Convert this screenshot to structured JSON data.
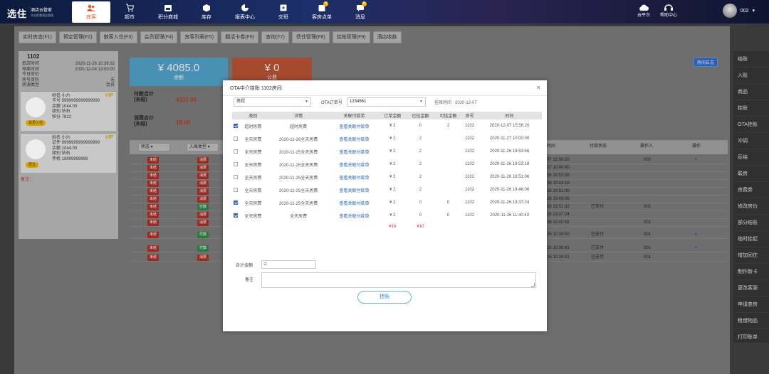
{
  "app": {
    "logo_main": "选住",
    "logo_name": "酒店云管家",
    "logo_tagline": "开启智慧酒店管理"
  },
  "nav": [
    {
      "label": "宾客",
      "icon": "users-icon",
      "active": true
    },
    {
      "label": "超市",
      "icon": "cart-icon"
    },
    {
      "label": "积分商城",
      "icon": "shop-icon"
    },
    {
      "label": "库存",
      "icon": "box-icon"
    },
    {
      "label": "报表中心",
      "icon": "pie-chart-icon"
    },
    {
      "label": "交班",
      "icon": "handover-icon"
    },
    {
      "label": "客房点单",
      "icon": "room-order-icon",
      "badge": "0"
    },
    {
      "label": "消息",
      "icon": "message-icon",
      "badge": "8"
    }
  ],
  "topright": {
    "cloud_label": "云平台",
    "help_label": "帮助中心",
    "user": "002"
  },
  "tabs": [
    "实时房态(F1)",
    "预定管理(F2)",
    "散客入住(F3)",
    "会员管理(F4)",
    "宾客列表(F5)",
    "翻活卡卷(F6)",
    "查询(F7)",
    "债住管理(F8)",
    "挂账管理(F9)",
    "酒店收款"
  ],
  "room": {
    "number": "1102",
    "fields": [
      {
        "k": "抵店时间",
        "v": "2020-11-26 10:39:32"
      },
      {
        "k": "预离时间",
        "v": "2020-12-04 13:00:00"
      },
      {
        "k": "今日房价",
        "v": ""
      },
      {
        "k": "房号资料",
        "v": "无"
      },
      {
        "k": "房源类型",
        "v": "会员"
      }
    ]
  },
  "guests": [
    {
      "name": "姓名 小六",
      "card": "卡号 9999999999999999",
      "balance": "余额 1044.00",
      "level": "级别 钻石",
      "points": "积分 7822",
      "vip": "VIP",
      "btn": "会员入住"
    },
    {
      "name": "姓名 小六",
      "card": "证件 9999999999999999",
      "balance": "余额 1044.00",
      "level": "级别 钻石",
      "points": "手机 18999999999",
      "vip": "VIP",
      "btn": "再五"
    }
  ],
  "remark_label": "备注：",
  "cards": {
    "balance": "¥ 4085.0",
    "balance_label": "余额",
    "deposit": "¥ 0",
    "deposit_label": "公费"
  },
  "summary": {
    "paid_label": "付款合计\n(未结)",
    "paid_value": "4101.00",
    "consume_label": "消费合计\n(未结)",
    "consume_value": "16.00"
  },
  "filter": {
    "status": "状态",
    "type": "入账类型",
    "time_col": "时间",
    "pay_col": "付款状态",
    "operator_col": "操作人",
    "op_col": "操作"
  },
  "log_button": "房间日志",
  "list_rows": [
    {
      "a": "未结",
      "b": "消费",
      "time": "07 15:56:20",
      "pay": "",
      "op": "002",
      "chev": true
    },
    {
      "a": "未结",
      "b": "消费",
      "time": "27 10:00:00",
      "pay": "",
      "op": "",
      "chev": false
    },
    {
      "a": "未结",
      "b": "消费",
      "time": "26 19:53:56",
      "pay": "",
      "op": "",
      "chev": false
    },
    {
      "a": "未结",
      "b": "消费",
      "time": "26 19:53:18",
      "pay": "",
      "op": "",
      "chev": false
    },
    {
      "a": "未结",
      "b": "消费",
      "time": "26 19:51:06",
      "pay": "",
      "op": "",
      "chev": false
    },
    {
      "a": "未结",
      "b": "消费",
      "time": "26 19:48:06",
      "pay": "",
      "op": "",
      "chev": false
    },
    {
      "a": "未结",
      "b": "付款",
      "time": "26 13:51:32",
      "pay": "已支付",
      "op": "001",
      "chev": false,
      "g": true
    },
    {
      "a": "未结",
      "b": "消费",
      "time": "26 13:37:24",
      "pay": "",
      "op": "",
      "chev": false
    },
    {
      "a": "未结",
      "b": "消费",
      "time": "26 11:40:43",
      "pay": "",
      "op": "001",
      "chev": false
    },
    {
      "a": "未结",
      "b": "付款",
      "time": "26 10:39:50",
      "pay": "已支付",
      "op": "001",
      "chev": true,
      "g": true
    },
    {
      "a": "未结",
      "b": "付款",
      "time": "26 10:39:41",
      "pay": "已支付",
      "op": "001",
      "chev": true,
      "g": true
    },
    {
      "a": "未结",
      "b": "消费",
      "time": "26 10:39:41",
      "pay": "已支付",
      "op": "001",
      "chev": false
    }
  ],
  "right_menu": [
    "结账",
    "入账",
    "商品",
    "挂账",
    "OTA挂账",
    "冲调",
    "反结",
    "联房",
    "房费券",
    "修改房价",
    "部分结账",
    "临时挂起",
    "增加同住",
    "制作新卡",
    "更改客源",
    "申请查房",
    "租借物品",
    "打印账单"
  ],
  "modal": {
    "title": "OTA中介挂账 1102房间",
    "close": "×",
    "channel": "携程",
    "ota_label": "OTA订单号",
    "ota_value": "1234561",
    "time_label": "挂账时间",
    "time_value": "2020-12-07",
    "headers": [
      "",
      "类别",
      "详情",
      "关联付款单",
      "订单金额",
      "已挂金额",
      "可挂金额",
      "房号",
      "时间"
    ],
    "rows": [
      {
        "checked": true,
        "cat": "超时房费",
        "detail": "超时房费",
        "link": "查看关联付款单",
        "amount": "¥ 2",
        "paid": "0",
        "avail": "2",
        "room": "1102",
        "time": "2020-12-07 15:56:20"
      },
      {
        "checked": false,
        "cat": "全天房费",
        "detail": "2020-11-26全天房费",
        "link": "查看关联付款单",
        "amount": "¥ 2",
        "paid": "2",
        "avail": "",
        "room": "1102",
        "time": "2020-11-27 10:00:00"
      },
      {
        "checked": false,
        "cat": "全天房费",
        "detail": "2020-11-25全天房费",
        "link": "查看关联付款单",
        "amount": "¥ 2",
        "paid": "2",
        "avail": "",
        "room": "1102",
        "time": "2020-11-26 19:53:56"
      },
      {
        "checked": false,
        "cat": "全天房费",
        "detail": "2020-11-25全天房费",
        "link": "查看关联付款单",
        "amount": "¥ 2",
        "paid": "2",
        "avail": "",
        "room": "1102",
        "time": "2020-11-26 19:53:18"
      },
      {
        "checked": false,
        "cat": "全天房费",
        "detail": "2020-11-25全天房费",
        "link": "查看关联付款单",
        "amount": "¥ 2",
        "paid": "2",
        "avail": "",
        "room": "1102",
        "time": "2020-11-26 19:51:06"
      },
      {
        "checked": false,
        "cat": "全天房费",
        "detail": "2020-11-25全天房费",
        "link": "查看关联付款单",
        "amount": "¥ 2",
        "paid": "2",
        "avail": "",
        "room": "1102",
        "time": "2020-11-26 19:48:06"
      },
      {
        "checked": true,
        "cat": "全天房费",
        "detail": "2020-11-25全天房费",
        "link": "查看关联付款单",
        "amount": "¥ 2",
        "paid": "0",
        "avail": "0",
        "room": "1102",
        "time": "2020-11-26 13:37:24"
      },
      {
        "checked": true,
        "cat": "全天房费",
        "detail": "全天房费",
        "link": "查看关联付款单",
        "amount": "¥ 2",
        "paid": "0",
        "avail": "0",
        "room": "1102",
        "time": "2020-11-26 11:40:43"
      }
    ],
    "total_amount": "¥16",
    "total_paid": "¥10",
    "sum_label": "合计金额",
    "sum_value": "2",
    "remark_label": "备注",
    "submit": "挂账"
  }
}
